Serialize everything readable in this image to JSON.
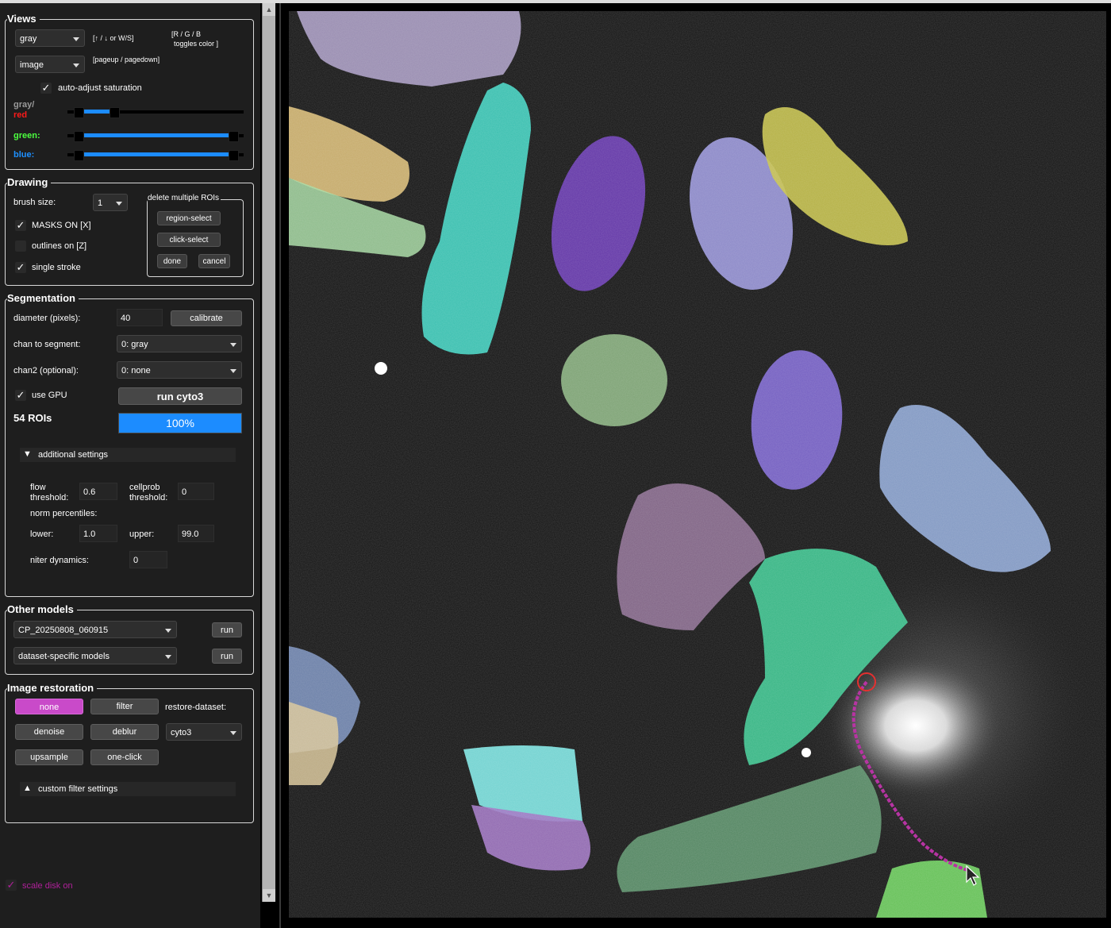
{
  "views": {
    "title": "Views",
    "color_mode": "gray",
    "color_hint": "[↑ / ↓ or W/S]",
    "rgb_hint_line1": "[R / G / B",
    "rgb_hint_line2": "toggles color ]",
    "view_mode": "image",
    "page_hint": "[pageup / pagedown]",
    "auto_adjust_label": "auto-adjust saturation",
    "gray_label": "gray/",
    "red_label": "red",
    "green_label": "green:",
    "blue_label": "blue:",
    "gray_level": [
      0.04,
      0.25
    ],
    "green_level": [
      0.04,
      0.96
    ],
    "blue_level": [
      0.04,
      0.96
    ],
    "colors": {
      "red": "#ff1a1a",
      "green": "#4cff3f",
      "blue": "#1e90ff"
    }
  },
  "drawing": {
    "title": "Drawing",
    "brush_size_label": "brush size:",
    "brush_size": "1",
    "masks_label": "MASKS ON [X]",
    "outlines_label": "outlines on [Z]",
    "single_stroke_label": "single stroke",
    "delete_title": "delete multiple ROIs",
    "region_select": "region-select",
    "click_select": "click-select",
    "done": "done",
    "cancel": "cancel"
  },
  "segmentation": {
    "title": "Segmentation",
    "diameter_label": "diameter (pixels):",
    "diameter": "40",
    "calibrate": "calibrate",
    "chan_label": "chan to segment:",
    "chan_value": "0: gray",
    "chan2_label": "chan2 (optional):",
    "chan2_value": "0: none",
    "gpu_label": "use GPU",
    "run_label": "run cyto3",
    "rois": "54 ROIs",
    "progress_text": "100%",
    "progress": 1.0,
    "additional_label": "additional settings",
    "flow_label1": "flow",
    "flow_label2": "threshold:",
    "flow_value": "0.6",
    "cellprob_label1": "cellprob",
    "cellprob_label2": "threshold:",
    "cellprob_value": "0",
    "norm_label": "norm percentiles:",
    "lower_label": "lower:",
    "lower_value": "1.0",
    "upper_label": "upper:",
    "upper_value": "99.0",
    "niter_label": "niter dynamics:",
    "niter_value": "0"
  },
  "other_models": {
    "title": "Other models",
    "model1": "CP_20250808_060915",
    "model2": "dataset-specific models",
    "run": "run"
  },
  "restoration": {
    "title": "Image restoration",
    "none": "none",
    "filter": "filter",
    "restore_label": "restore-dataset:",
    "denoise": "denoise",
    "deblur": "deblur",
    "dataset": "cyto3",
    "upsample": "upsample",
    "one_click": "one-click",
    "custom_label": "custom filter settings"
  },
  "footer": {
    "scale_disk": "scale disk on",
    "scale_color": "#b0209a"
  },
  "accent": {
    "progress": "#1c8cff",
    "none_button": "#c94ac9"
  }
}
